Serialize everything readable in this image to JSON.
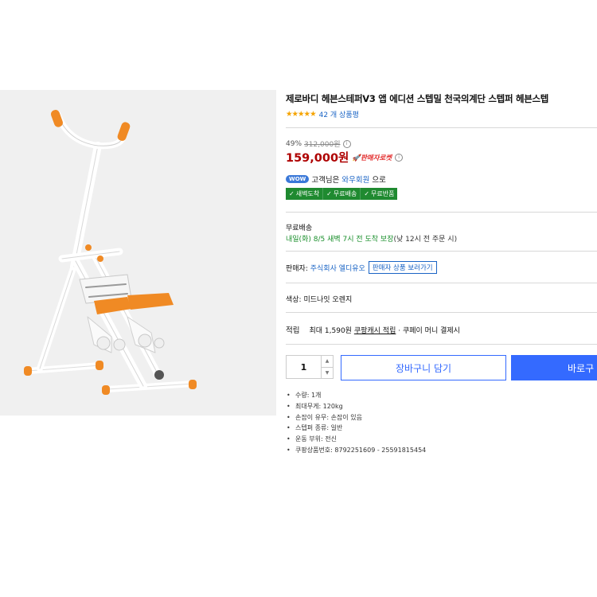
{
  "product": {
    "title": "제로바디 헤븐스테퍼V3 앱 에디션 스텝밀 천국의계단 스텝퍼 헤븐스텝",
    "stars": "★★★★★",
    "reviews": "42 개 상품평",
    "discount_rate": "49%",
    "original_price": "312,000원",
    "price": "159,000원",
    "seller_rocket": "판매자로켓"
  },
  "member": {
    "badge": "WOW",
    "text_prefix": "고객님은 ",
    "link": "와우회원",
    "text_suffix": "으로"
  },
  "badges": [
    "새벽도착",
    "무료배송",
    "무료반품"
  ],
  "delivery": {
    "title": "무료배송",
    "green": "내일(화) 8/5 새벽 7시 전 도착 보장",
    "grey": "(낮 12시 전 주문 시)"
  },
  "seller": {
    "label": "판매자: ",
    "name": "주식회사 엘디유오",
    "button": "판매자 상품 보러가기"
  },
  "option": "색상: 미드나잇 오렌지",
  "reward": {
    "label": "적립",
    "max": "최대 1,590원",
    "cash": "쿠팡캐시 적립",
    "pay": "· 쿠페이 머니 결제시"
  },
  "cart": {
    "quantity": "1",
    "add_to_cart": "장바구니 담기",
    "buy_now": "바로구"
  },
  "specs": [
    "수량: 1개",
    "최대무게: 120kg",
    "손잡이 유무: 손잡이 있음",
    "스텝퍼 종류: 일반",
    "운동 부위: 전신",
    "쿠팡상품번호: 8792251609 - 25591815454"
  ],
  "colors": {
    "accent": "#346aff",
    "price": "#ae0000",
    "delivery": "#1a8f2c",
    "product_orange": "#f08a24"
  }
}
